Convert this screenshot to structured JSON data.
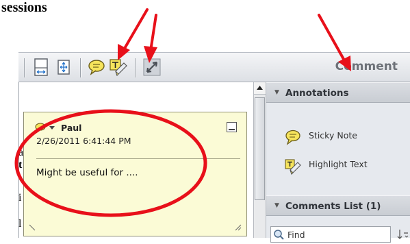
{
  "caption": {
    "text": "sessions"
  },
  "toolbar": {
    "comment_label": "Comment",
    "buttons": [
      "fit-page-icon",
      "fit-width-icon",
      "sticky-note-icon",
      "highlight-text-icon",
      "full-screen-icon"
    ]
  },
  "document": {
    "fragments": [
      "a",
      "t",
      "i",
      "l"
    ]
  },
  "note": {
    "author": "Paul",
    "date": "2/26/2011 6:41:44 PM",
    "body": "Might be useful for ...."
  },
  "panel": {
    "annotations": {
      "title": "Annotations",
      "items": [
        {
          "label": "Sticky Note",
          "icon": "sticky-note-icon"
        },
        {
          "label": "Highlight Text",
          "icon": "highlight-text-icon"
        }
      ]
    },
    "comments_list": {
      "title": "Comments List (1)"
    },
    "find": {
      "label": "Find"
    }
  },
  "colors": {
    "annotation_red": "#e8101a",
    "note_yellow": "#fbfbd6",
    "icon_yellow": "#f6e45c"
  }
}
